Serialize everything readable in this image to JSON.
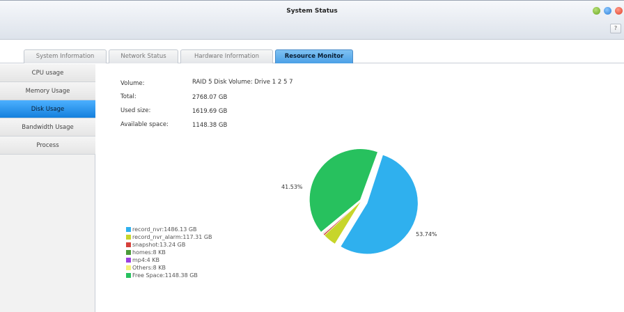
{
  "window": {
    "title": "System Status",
    "help_label": "?"
  },
  "tabs": [
    {
      "label": "System Information",
      "active": false
    },
    {
      "label": "Network Status",
      "active": false
    },
    {
      "label": "Hardware Information",
      "active": false
    },
    {
      "label": "Resource Monitor",
      "active": true
    }
  ],
  "sidebar": {
    "items": [
      {
        "label": "CPU usage",
        "active": false
      },
      {
        "label": "Memory Usage",
        "active": false
      },
      {
        "label": "Disk Usage",
        "active": true
      },
      {
        "label": "Bandwidth Usage",
        "active": false
      },
      {
        "label": "Process",
        "active": false
      }
    ]
  },
  "disk": {
    "volume_label": "Volume:",
    "volume_value": "RAID 5 Disk Volume: Drive 1 2 5 7",
    "total_label": "Total:",
    "total_value": "2768.07 GB",
    "used_label": "Used size:",
    "used_value": "1619.69 GB",
    "available_label": "Available space:",
    "available_value": "1148.38 GB"
  },
  "chart_data": {
    "type": "pie",
    "slices": [
      {
        "label": "record_nvr:1486.13 GB",
        "value": 53.74,
        "color": "#2fb0ee"
      },
      {
        "label": "record_nvr_alarm:117.31 GB",
        "value": 4.24,
        "color": "#c7d52a"
      },
      {
        "label": "snapshot:13.24 GB",
        "value": 0.48,
        "color": "#d6403a"
      },
      {
        "label": "homes:8 KB",
        "value": 0.003,
        "color": "#4a9a3a"
      },
      {
        "label": "mp4:4 KB",
        "value": 0.001,
        "color": "#9b3fe0"
      },
      {
        "label": "Others:8 KB",
        "value": 0.003,
        "color": "#f4f27a"
      },
      {
        "label": "Free Space:1148.38 GB",
        "value": 41.53,
        "color": "#27c15e"
      }
    ],
    "percent_labels": [
      "53.74%",
      "41.53%"
    ]
  }
}
